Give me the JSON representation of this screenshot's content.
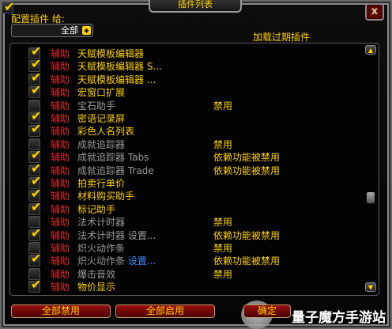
{
  "window": {
    "title": "插件列表",
    "close_label": "x"
  },
  "config": {
    "label": "配置插件 给:",
    "dropdown_value": "全部",
    "dropdown_arrow": "◆"
  },
  "load_outdated": {
    "label": "加载过期插件",
    "checked": true
  },
  "tick_glyph": "✔",
  "rows": [
    {
      "checked": true,
      "prefix": "辅助",
      "name": "天赋模板编辑器",
      "name_style": "ok",
      "link": "",
      "status": ""
    },
    {
      "checked": true,
      "prefix": "辅助",
      "name": "天赋模板编辑器 S...",
      "name_style": "ok",
      "link": "",
      "status": ""
    },
    {
      "checked": true,
      "prefix": "辅助",
      "name": "天赋模板编辑器 ...",
      "name_style": "ok",
      "link": "",
      "status": ""
    },
    {
      "checked": true,
      "prefix": "辅助",
      "name": "宏窗口扩展",
      "name_style": "ok",
      "link": "",
      "status": ""
    },
    {
      "checked": false,
      "prefix": "辅助",
      "name": "宝石助手",
      "name_style": "dim",
      "link": "",
      "status": "禁用"
    },
    {
      "checked": true,
      "prefix": "辅助",
      "name": "密语记录屏",
      "name_style": "ok",
      "link": "",
      "status": ""
    },
    {
      "checked": true,
      "prefix": "辅助",
      "name": "彩色人名列表",
      "name_style": "ok",
      "link": "",
      "status": ""
    },
    {
      "checked": false,
      "prefix": "辅助",
      "name": "成就追踪器",
      "name_style": "dim",
      "link": "",
      "status": "禁用"
    },
    {
      "checked": true,
      "prefix": "辅助",
      "name": "成就追踪器 Tabs",
      "name_style": "dim",
      "link": "",
      "status": "依赖功能被禁用"
    },
    {
      "checked": true,
      "prefix": "辅助",
      "name": "成就追踪器 Trade",
      "name_style": "dim",
      "link": "",
      "status": "依赖功能被禁用"
    },
    {
      "checked": true,
      "prefix": "辅助",
      "name": "拍卖行单价",
      "name_style": "ok",
      "link": "",
      "status": ""
    },
    {
      "checked": true,
      "prefix": "辅助",
      "name": "材料购买助手",
      "name_style": "ok",
      "link": "",
      "status": ""
    },
    {
      "checked": true,
      "prefix": "辅助",
      "name": "标记助手",
      "name_style": "ok",
      "link": "",
      "status": ""
    },
    {
      "checked": false,
      "prefix": "辅助",
      "name": "法术计时器",
      "name_style": "dim",
      "link": "",
      "status": "禁用"
    },
    {
      "checked": true,
      "prefix": "辅助",
      "name": "法术计时器 设置...",
      "name_style": "dim",
      "link": "",
      "status": "依赖功能被禁用"
    },
    {
      "checked": false,
      "prefix": "辅助",
      "name": "炽火动作条",
      "name_style": "dim",
      "link": "",
      "status": "禁用"
    },
    {
      "checked": true,
      "prefix": "辅助",
      "name": "炽火动作条 ",
      "name_style": "dim",
      "link": "设置...",
      "status": "依赖功能被禁用"
    },
    {
      "checked": false,
      "prefix": "辅助",
      "name": "爆击音效",
      "name_style": "dim",
      "link": "",
      "status": "禁用"
    },
    {
      "checked": true,
      "prefix": "辅助",
      "name": "物价显示",
      "name_style": "ok",
      "link": "",
      "status": ""
    }
  ],
  "scrollbar": {
    "up_glyph": "▲",
    "down_glyph": "▼"
  },
  "buttons": {
    "disable_all": "全部禁用",
    "enable_all": "全部启用",
    "ok": "确定"
  },
  "watermark": "量子魔方手游站"
}
